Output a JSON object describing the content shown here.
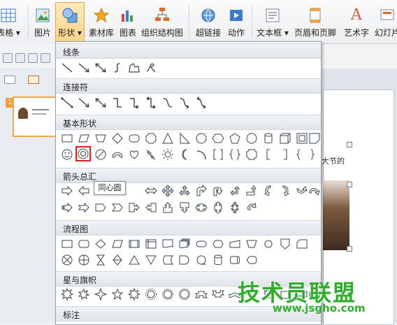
{
  "ribbon": {
    "buttons": [
      {
        "label": "表格 ▾",
        "icon": "table-icon"
      },
      {
        "label": "图片",
        "icon": "picture-icon"
      },
      {
        "label": "形状 ▾",
        "icon": "shapes-icon"
      },
      {
        "label": "素材库",
        "icon": "star-icon"
      },
      {
        "label": "图表",
        "icon": "chart-icon"
      },
      {
        "label": "组织结构图",
        "icon": "org-chart-icon"
      },
      {
        "label": "超链接",
        "icon": "hyperlink-icon"
      },
      {
        "label": "动作",
        "icon": "action-icon"
      },
      {
        "label": "文本框 ▾",
        "icon": "textbox-icon"
      },
      {
        "label": "页眉和页脚",
        "icon": "header-footer-icon"
      },
      {
        "label": "艺术字",
        "icon": "wordart-icon"
      },
      {
        "label": "幻灯片",
        "icon": "slide-icon"
      }
    ],
    "active_color": "#fbd58a"
  },
  "thumbnails": {
    "slide_number": "1"
  },
  "slide": {
    "visible_text": "大节的"
  },
  "shapes_menu": {
    "sections": {
      "lines": "线条",
      "connectors": "连接符",
      "basic": "基本形状",
      "arrows": "箭头总汇",
      "flowchart": "流程图",
      "stars": "星与旗帜",
      "callouts": "标注"
    },
    "tooltip": "同心圆",
    "selected_shape": "donut-shape"
  },
  "watermark": {
    "title": "技术员联盟",
    "url": "www.jsgho.com",
    "color": "#2eaf29"
  }
}
